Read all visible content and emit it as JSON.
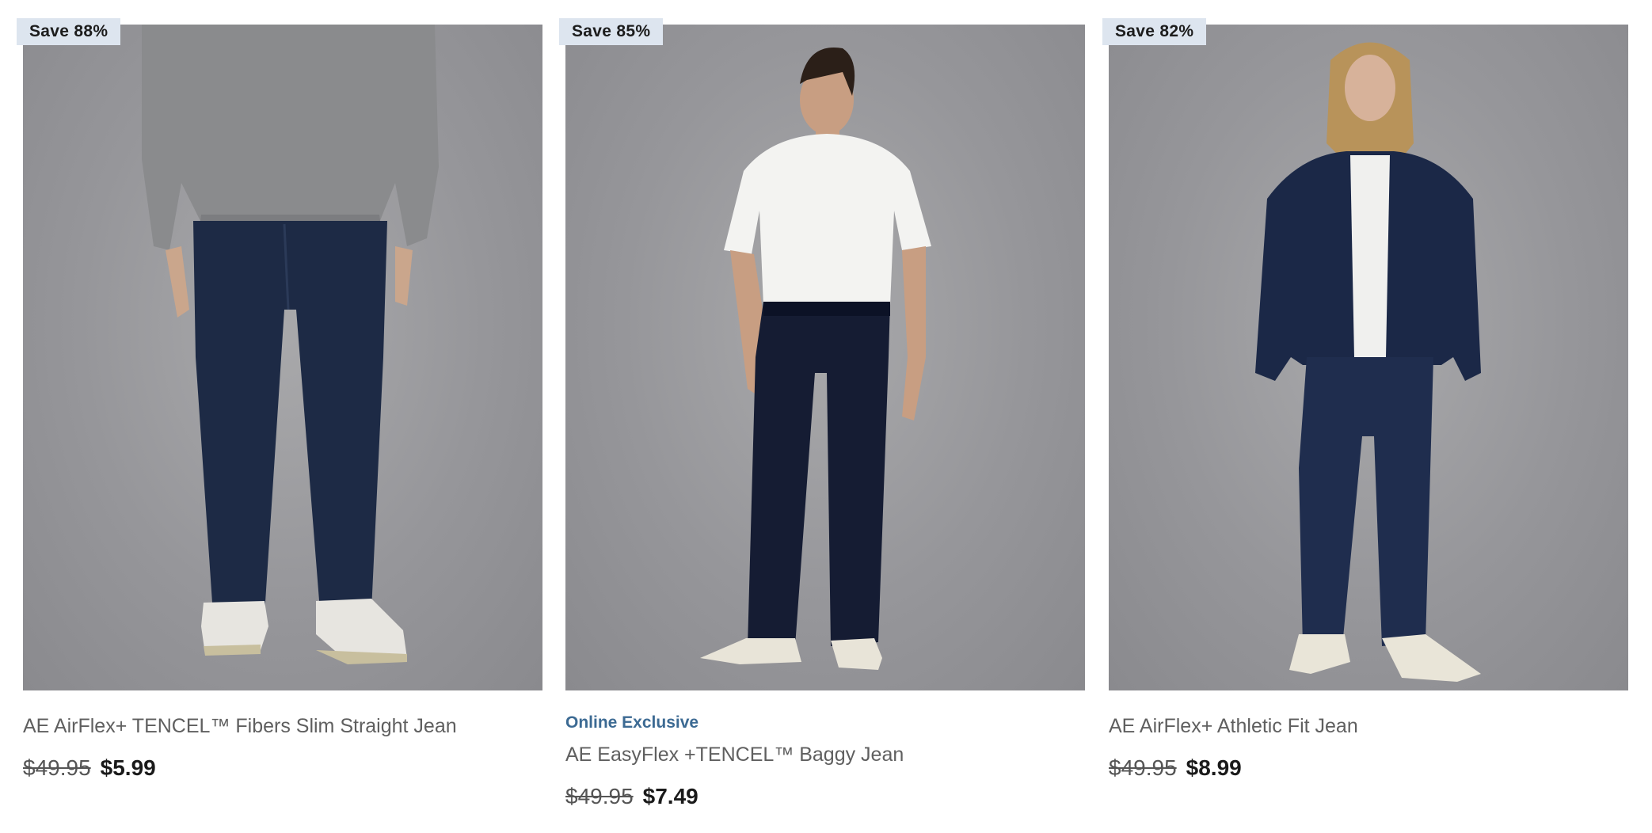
{
  "products": [
    {
      "badge": "Save 88%",
      "online_exclusive": "",
      "name": "AE AirFlex+ TENCEL™ Fibers Slim Straight Jean",
      "was_price": "$49.95",
      "sale_price": "$5.99"
    },
    {
      "badge": "Save 85%",
      "online_exclusive": "Online Exclusive",
      "name": "AE EasyFlex +TENCEL™ Baggy Jean",
      "was_price": "$49.95",
      "sale_price": "$7.49"
    },
    {
      "badge": "Save 82%",
      "online_exclusive": "",
      "name": "AE AirFlex+ Athletic Fit Jean",
      "was_price": "$49.95",
      "sale_price": "$8.99"
    }
  ],
  "colors": {
    "badge_bg": "#dde5ef",
    "exclusive_text": "#3c6a93",
    "studio_bg": "#96969a",
    "denim_dark": "#1d2a45"
  }
}
